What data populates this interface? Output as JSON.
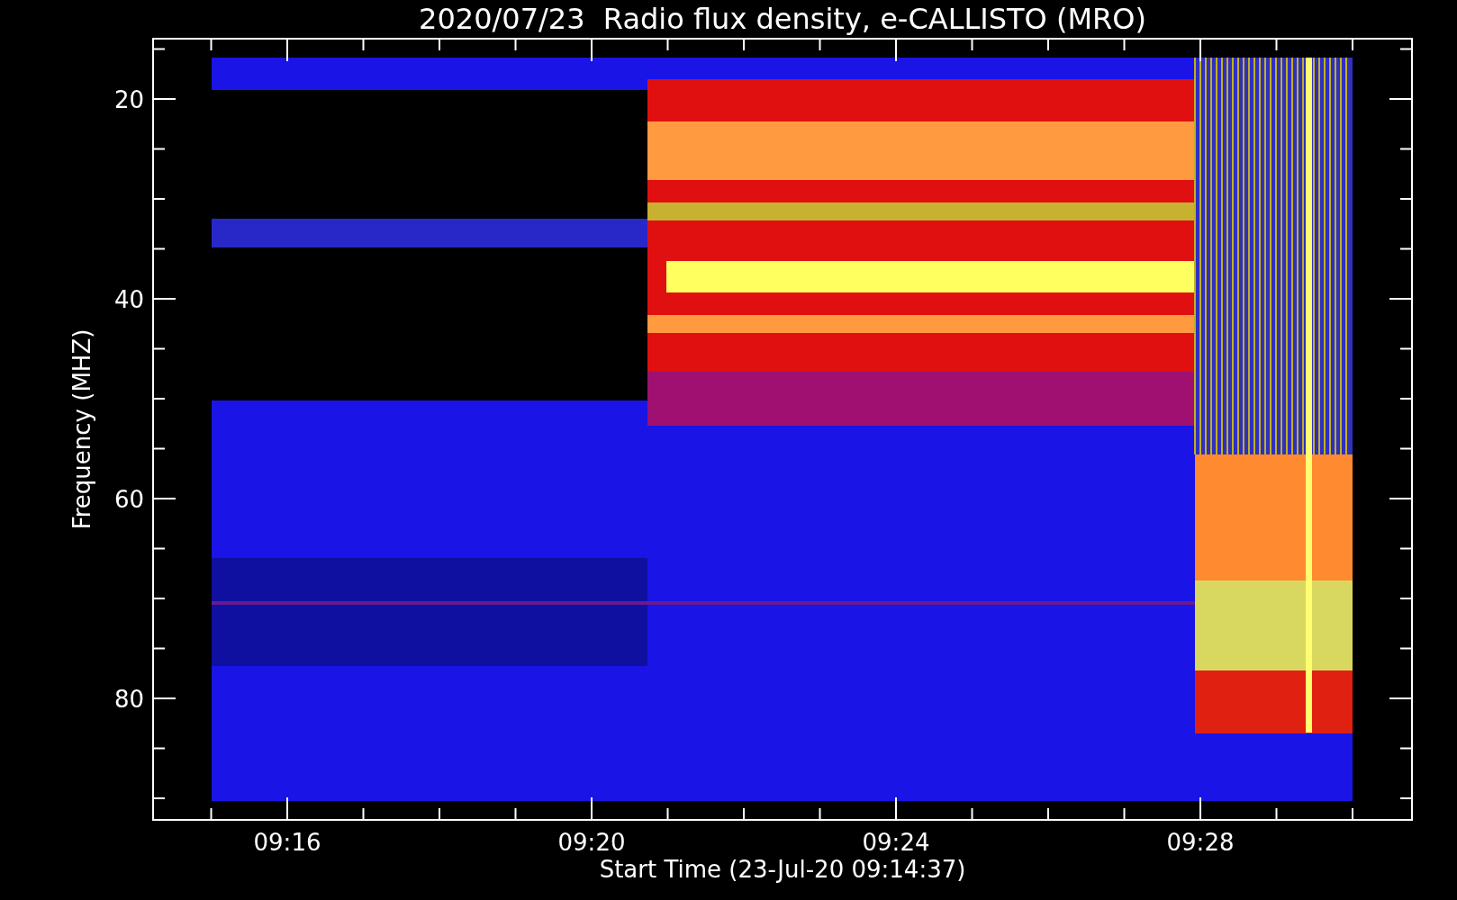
{
  "title": "2020/07/23  Radio flux density, e-CALLISTO (MRO)",
  "ylabel": "Frequency (MHZ)",
  "xlabel": "Start Time (23-Jul-20 09:14:37)",
  "yticks": [
    "20",
    "40",
    "60",
    "80"
  ],
  "xticks": [
    "09:16",
    "09:20",
    "09:24",
    "09:28"
  ]
}
